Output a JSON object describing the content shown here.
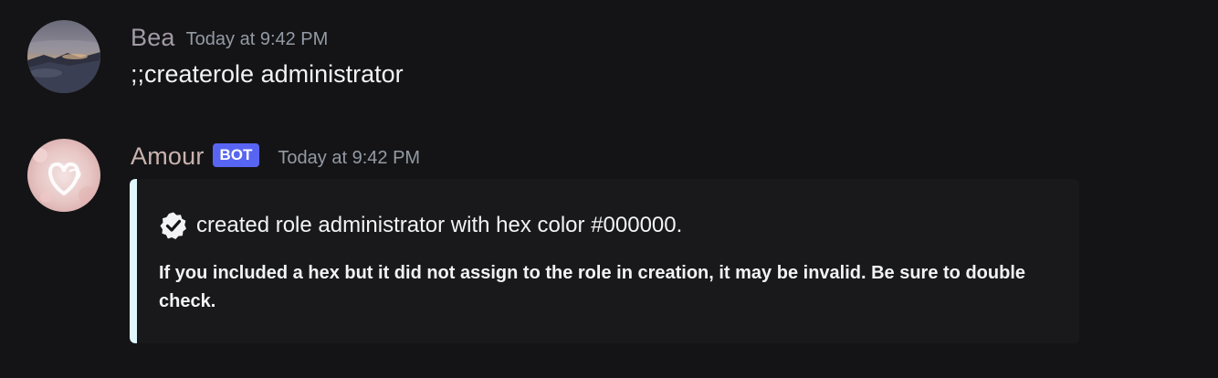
{
  "messages": [
    {
      "username": "Bea",
      "timestamp": "Today at 9:42 PM",
      "content": ";;createrole administrator",
      "avatar_icon": "landscape-photo-avatar"
    },
    {
      "username": "Amour",
      "badge": "BOT",
      "timestamp": "Today at 9:42 PM",
      "avatar_icon": "heart-avatar",
      "embed": {
        "accent_color": "#dff7fb",
        "icon": "verified-check-icon",
        "title": "created role administrator with hex color #000000.",
        "description": "If you included a hex but it did not assign to the role in creation, it may be invalid. Be sure to double check."
      }
    }
  ],
  "colors": {
    "background": "#141416",
    "bot_badge": "#5865f2",
    "timestamp": "#949ba4"
  }
}
